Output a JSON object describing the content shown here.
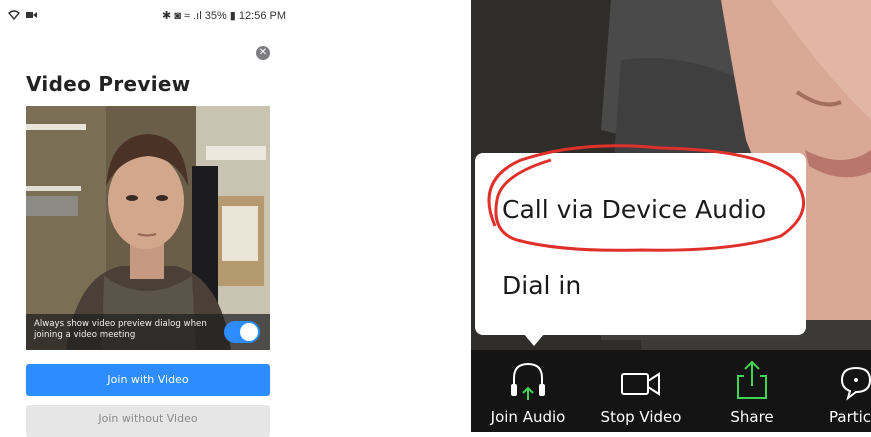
{
  "status_bar": {
    "left_icons": [
      "wifi-icon",
      "camera-icon"
    ],
    "right_text": "✱ ◙ ≈ .ıl 35% ▮ 12:56 PM"
  },
  "video_preview": {
    "title": "Video Preview",
    "preference_text": "Always show video preview dialog when joining a video meeting",
    "preference_toggle_on": true,
    "join_with_video_label": "Join with Video",
    "join_without_video_label": "Join without Video",
    "accent_color": "#2d8cff"
  },
  "audio_menu": {
    "items": [
      {
        "label": "Call via Device Audio",
        "highlighted": true
      },
      {
        "label": "Dial in",
        "highlighted": false
      }
    ],
    "annotation_color": "#e0302a"
  },
  "meeting_toolbar": {
    "items": [
      {
        "label": "Join Audio",
        "icon": "headphones-icon"
      },
      {
        "label": "Stop Video",
        "icon": "video-camera-icon"
      },
      {
        "label": "Share",
        "icon": "share-icon"
      },
      {
        "label": "Partic",
        "icon": "chat-icon"
      }
    ]
  }
}
